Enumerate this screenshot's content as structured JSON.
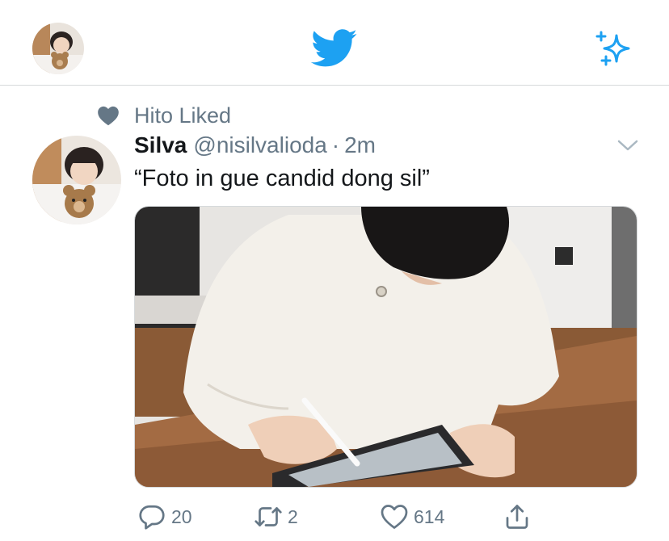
{
  "colors": {
    "accent": "#1da1f2",
    "muted": "#657786",
    "text": "#14171a"
  },
  "header": {
    "avatar_icon": "profile-avatar",
    "logo_icon": "twitter-bird-icon",
    "top_tweets_icon": "sparkle-icon"
  },
  "tweet": {
    "social_context": "Hito Liked",
    "author_name": "Silva",
    "author_handle": "@nisilvalioda",
    "separator": "·",
    "time": "2m",
    "text": "“Foto in gue candid dong sil”",
    "media_description_icon": "photo-person-drawing-on-tablet",
    "actions": {
      "reply_count": "20",
      "retweet_count": "2",
      "like_count": "614"
    }
  }
}
